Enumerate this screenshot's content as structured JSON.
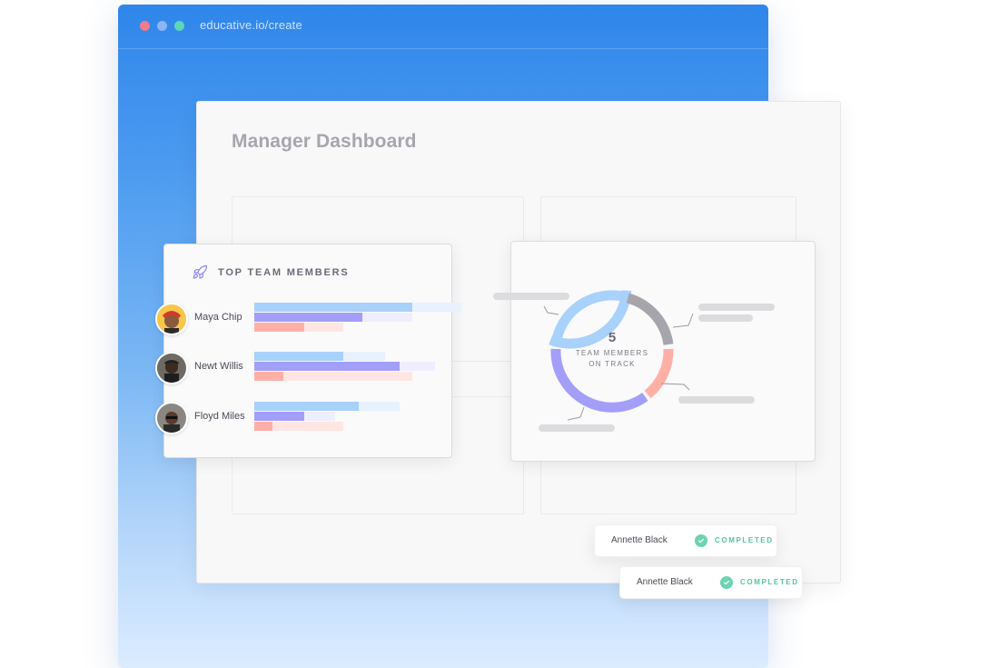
{
  "browser": {
    "url": "educative.io/create"
  },
  "dashboard": {
    "title": "Manager Dashboard"
  },
  "team_card": {
    "title": "TOP TEAM MEMBERS",
    "icon": "rocket-icon",
    "members": [
      {
        "name": "Maya Chip"
      },
      {
        "name": "Newt Willis"
      },
      {
        "name": "Floyd Miles"
      }
    ]
  },
  "donut": {
    "value": "5",
    "line1": "TEAM MEMBERS",
    "line2": "ON TRACK"
  },
  "toasts": [
    {
      "name": "Annette Black",
      "status": "COMPLETED"
    },
    {
      "name": "Annette Black",
      "status": "COMPLETED"
    }
  ],
  "colors": {
    "blue_bar": "#a8d1fb",
    "purple_bar": "#a39ef8",
    "salmon_bar": "#ffb0a6",
    "gray_segment": "#a5a5ab",
    "accent_green": "#6dd3b2",
    "browser_blue": "#2f86ea"
  }
}
